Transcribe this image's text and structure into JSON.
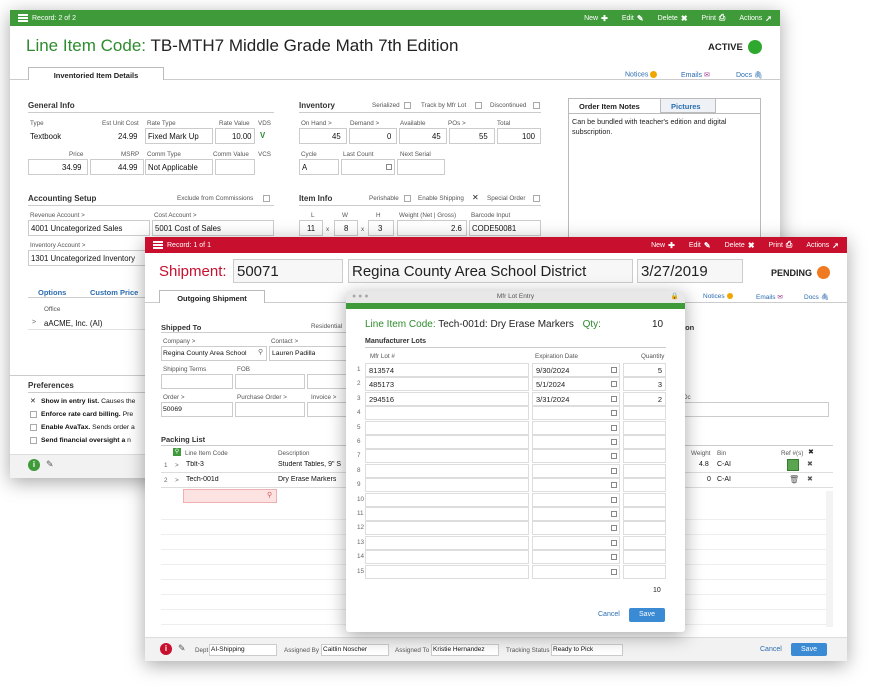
{
  "win1": {
    "record": "Record: 2 of 2",
    "actions": [
      "New",
      "Edit",
      "Delete",
      "Print",
      "Actions"
    ],
    "title_label": "Line Item Code:",
    "title_value": "TB-MTH7 Middle Grade Math 7th Edition",
    "status": "ACTIVE",
    "tab": "Inventoried Item Details",
    "links": [
      "Notices",
      "Emails",
      "Docs"
    ],
    "general": {
      "heading": "General Info",
      "type_label": "Type",
      "type": "Textbook",
      "euc_label": "Est Unit Cost",
      "euc": "24.99",
      "rate_type_label": "Rate Type",
      "rate_type": "Fixed Mark Up",
      "rate_value_label": "Rate Value",
      "rate_value": "10.00",
      "vds_label": "VDS",
      "vds": "V",
      "price_label": "Price",
      "price": "34.99",
      "msrp_label": "MSRP",
      "msrp": "44.99",
      "comm_type_label": "Comm Type",
      "comm_type": "Not Applicable",
      "comm_value_label": "Comm Value",
      "vcs_label": "VCS"
    },
    "inventory": {
      "heading": "Inventory",
      "serialized": "Serialized",
      "track": "Track by Mfr Lot",
      "discontinued": "Discontinued",
      "cols": [
        "On Hand >",
        "Demand >",
        "Available",
        "POs >",
        "Total"
      ],
      "vals": [
        "45",
        "0",
        "45",
        "55",
        "100"
      ],
      "cycle_label": "Cycle",
      "cycle": "A",
      "last_count_label": "Last Count",
      "next_serial_label": "Next Serial"
    },
    "notes": {
      "tab1": "Order Item Notes",
      "tab2": "Pictures",
      "text": "Can be bundled with teacher's edition and digital subscription."
    },
    "accounting": {
      "heading": "Accounting Setup",
      "exclude": "Exclude from Commissions",
      "rev_label": "Revenue Account >",
      "rev": "4001 Uncategorized Sales",
      "cost_label": "Cost Account >",
      "cost": "5001 Cost of Sales",
      "inv_label": "Inventory Account >",
      "inv": "1301 Uncategorized Inventory"
    },
    "item_info": {
      "heading": "Item Info",
      "perishable": "Perishable",
      "enable_shipping": "Enable Shipping",
      "special_order": "Special Order",
      "l_label": "L",
      "w_label": "W",
      "h_label": "H",
      "l": "11",
      "w": "8",
      "h": "3",
      "weight_label": "Weight (Net | Gross)",
      "weight": "2.6",
      "barcode_label": "Barcode Input",
      "barcode": "CODE50081",
      "x": "x"
    },
    "options": {
      "tab1": "Options",
      "tab2": "Custom Price",
      "office_label": "Office",
      "office": "aACME, Inc. (AI)"
    },
    "prefs": {
      "heading": "Preferences",
      "items": [
        {
          "bold": "Show in entry list.",
          "rest": "Causes the"
        },
        {
          "bold": "Enforce rate card billing.",
          "rest": "Pre"
        },
        {
          "bold": "Enable AvaTax.",
          "rest": "Sends order a"
        },
        {
          "bold": "Send financial oversight a",
          "rest": "n"
        }
      ]
    }
  },
  "win2": {
    "record": "Record: 1 of 1",
    "actions": [
      "New",
      "Edit",
      "Delete",
      "Print",
      "Actions"
    ],
    "title_label": "Shipment:",
    "number": "50071",
    "customer": "Regina County Area School District",
    "date": "3/27/2019",
    "status": "PENDING",
    "tab": "Outgoing Shipment",
    "links": [
      "Notices",
      "Emails",
      "Docs"
    ],
    "shipped_to": "Shipped To",
    "residential": "Residential",
    "company_label": "Company >",
    "company": "Regina County Area School",
    "contact_label": "Contact >",
    "contact": "Lauren Padilla",
    "shipping_terms_label": "Shipping Terms",
    "fob_label": "FOB",
    "order_label": "Order >",
    "order": "50069",
    "po_label": "Purchase Order >",
    "invoice_label": "Invoice >",
    "right_label": "ion",
    "right_label2": "Dc",
    "packing_list": "Packing List",
    "pl_cols": [
      "Line Item Code",
      "Description",
      "Weight",
      "Bin",
      "Ref #(s)"
    ],
    "pl_rows": [
      {
        "n": "1",
        "code": "Tblt-3",
        "desc": "Student Tables, 9\" S",
        "weight": "4.8",
        "bin": "C-AI"
      },
      {
        "n": "2",
        "code": "Tech-001d",
        "desc": "Dry Erase Markers",
        "weight": "0",
        "bin": "C-AI"
      }
    ],
    "footer": {
      "dept_label": "Dept",
      "dept": "AI-Shipping",
      "assigned_by_label": "Assigned By",
      "assigned_by": "Caitlin Noscher",
      "assigned_to_label": "Assigned To",
      "assigned_to": "Kristie Hernandez",
      "tracking_label": "Tracking Status",
      "tracking": "Ready to Pick",
      "cancel": "Cancel",
      "save": "Save"
    }
  },
  "modal": {
    "title": "Mfr Lot Entry",
    "code_label": "Line Item Code:",
    "code": "Tech-001d: Dry Erase Markers",
    "qty_label": "Qty:",
    "qty": "10",
    "section": "Manufacturer Lots",
    "cols": [
      "Mfr Lot #",
      "Expiration Date",
      "Quantity"
    ],
    "lots": [
      {
        "n": "1",
        "lot": "813574",
        "date": "9/30/2024",
        "qty": "5"
      },
      {
        "n": "2",
        "lot": "485173",
        "date": "5/1/2024",
        "qty": "3"
      },
      {
        "n": "3",
        "lot": "294516",
        "date": "3/31/2024",
        "qty": "2"
      },
      {
        "n": "4"
      },
      {
        "n": "5"
      },
      {
        "n": "6"
      },
      {
        "n": "7"
      },
      {
        "n": "8"
      },
      {
        "n": "9"
      },
      {
        "n": "10"
      },
      {
        "n": "11"
      },
      {
        "n": "12"
      },
      {
        "n": "13"
      },
      {
        "n": "14"
      },
      {
        "n": "15"
      }
    ],
    "total": "10",
    "cancel": "Cancel",
    "save": "Save"
  },
  "colors": {
    "green": "#3f9a3a",
    "red": "#c8102e",
    "link": "#2b6cb0",
    "blue": "#3b8ad4"
  }
}
